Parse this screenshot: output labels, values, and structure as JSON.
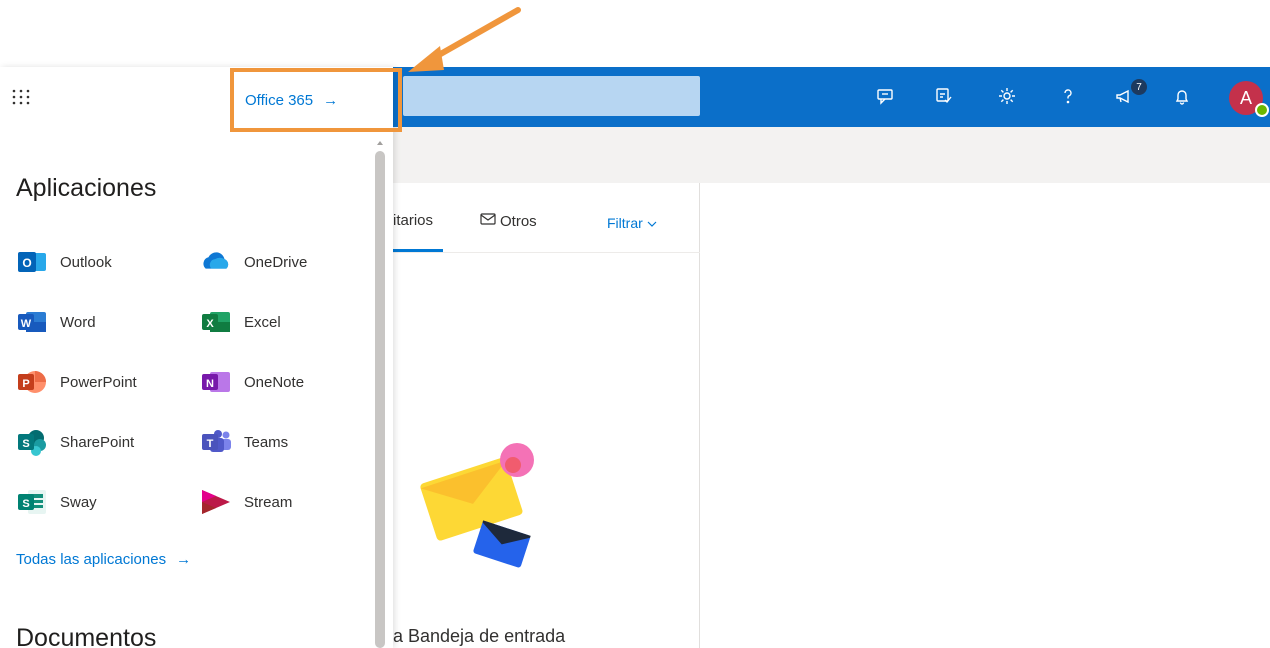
{
  "launcher": {
    "office_link_label": "Office 365",
    "office_link_arrow": "→",
    "apps_section_title": "Aplicaciones",
    "apps": [
      {
        "name": "Outlook",
        "icon": "outlook-icon"
      },
      {
        "name": "OneDrive",
        "icon": "onedrive-icon"
      },
      {
        "name": "Word",
        "icon": "word-icon"
      },
      {
        "name": "Excel",
        "icon": "excel-icon"
      },
      {
        "name": "PowerPoint",
        "icon": "powerpoint-icon"
      },
      {
        "name": "OneNote",
        "icon": "onenote-icon"
      },
      {
        "name": "SharePoint",
        "icon": "sharepoint-icon"
      },
      {
        "name": "Teams",
        "icon": "teams-icon"
      },
      {
        "name": "Sway",
        "icon": "sway-icon"
      },
      {
        "name": "Stream",
        "icon": "stream-icon"
      }
    ],
    "all_apps_label": "Todas las aplicaciones",
    "all_apps_arrow": "→",
    "documents_section_title": "Documentos"
  },
  "topbar": {
    "notification_count": "7",
    "avatar_initial": "A"
  },
  "message_list": {
    "tab_focused": "itarios",
    "tab_others": "Otros",
    "filter_label": "Filtrar",
    "empty_state_text": "a Bandeja de entrada"
  },
  "colors": {
    "topbar": "#0b6fc9",
    "accent": "#0078d4",
    "annotation": "#f0963c"
  }
}
